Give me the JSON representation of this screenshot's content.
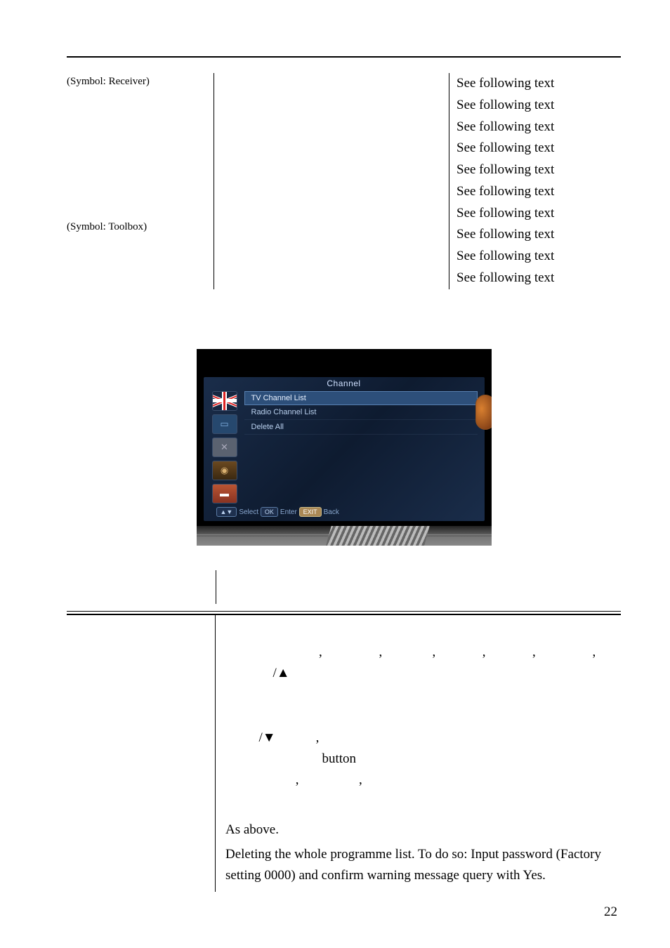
{
  "top": {
    "symbol_receiver": "(Symbol: Receiver)",
    "symbol_toolbox": "(Symbol: Toolbox)",
    "see_text_items": [
      "See following text",
      "See following text",
      "See following text",
      "See following text",
      "See following text",
      "See following text",
      "See following text",
      "See following text",
      "See following text",
      "See following text"
    ]
  },
  "osd": {
    "title": "Channel",
    "items": {
      "tv_list": "TV Channel List",
      "radio_list": "Radio Channel List",
      "delete_all": "Delete All"
    },
    "footer": {
      "select_badge": "▲▼",
      "select_label": "Select",
      "enter_badge": "OK",
      "enter_label": "Enter",
      "back_badge": "EXIT",
      "back_label": "Back"
    }
  },
  "bottom": {
    "row1_commas": "                  ,                 ,               ,              ,              ,                 ,",
    "row1_arrows_suffix": "/▲",
    "row1_line2_prefix": "/▼            ,",
    "row1_button": "button",
    "row1_line2_commas_after": "           ,                  ,",
    "row2": "As above.",
    "row3": "Deleting the whole programme list. To do so: Input password (Factory setting 0000) and confirm warning message query with Yes."
  },
  "page_number": "22"
}
